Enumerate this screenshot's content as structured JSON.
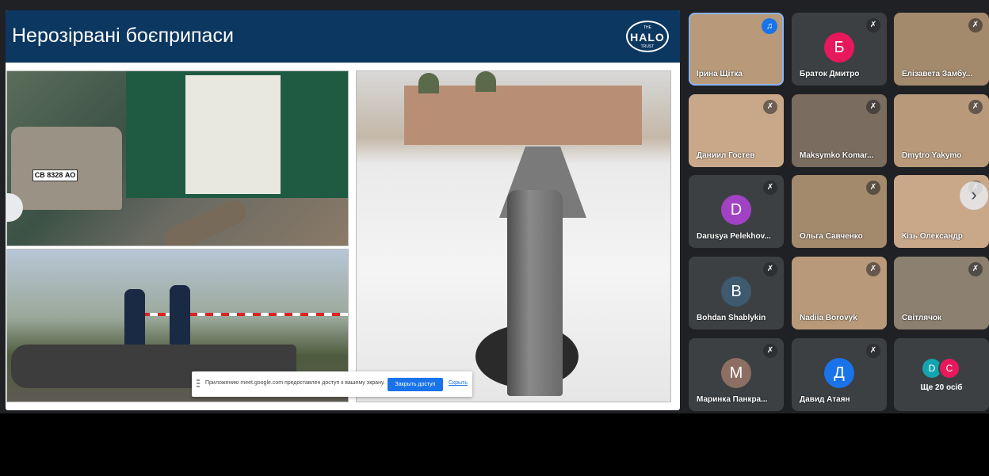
{
  "slide": {
    "title": "Нерозірвані боєприпаси",
    "logo": {
      "top": "THE",
      "main": "HALO",
      "bottom": "TRUST"
    },
    "license_plate": "СВ 8328 АО"
  },
  "share_bar": {
    "message": "Приложению meet.google.com предоставлен доступ к вашему экрану.",
    "stop_label": "Закрыть доступ",
    "hide_label": "Скрыть"
  },
  "participants": [
    {
      "name": "Ірина Щітка",
      "mic": "on"
    },
    {
      "name": "Браток Дмитро",
      "initial": "Б",
      "color": "#e8185c",
      "mic": "off"
    },
    {
      "name": "Елізавета Замбу...",
      "mic": "off"
    },
    {
      "name": "Даниил Гостев",
      "mic": "off"
    },
    {
      "name": "Maksymko Komar...",
      "mic": "off"
    },
    {
      "name": "Dmytro Yakymo",
      "mic": "off"
    },
    {
      "name": "Darusya Pelekhov...",
      "initial": "D",
      "color": "#a142c4",
      "mic": "off"
    },
    {
      "name": "Ольга Савченко",
      "mic": "off"
    },
    {
      "name": "Кізь Олександр",
      "mic": "off"
    },
    {
      "name": "Bohdan Shablykin",
      "initial": "B",
      "color": "#3d5a6e",
      "mic": "off"
    },
    {
      "name": "Nadiia Borovyk",
      "mic": "off"
    },
    {
      "name": "Світлячок",
      "mic": "off"
    },
    {
      "name": "Маринка Панкра...",
      "initial": "M",
      "color": "#8d6e63",
      "mic": "off"
    },
    {
      "name": "Давид Атаян",
      "initial": "Д",
      "color": "#1a73e8",
      "mic": "off"
    }
  ],
  "more": {
    "label": "Ще 20 осіб",
    "avatars": [
      {
        "initial": "D",
        "color": "#12a4af"
      },
      {
        "initial": "C",
        "color": "#e8185c"
      }
    ]
  },
  "icons": {
    "mic_off": "mic-off-icon",
    "mic_on": "mic-on-icon",
    "next": "chevron-right-icon",
    "prev": "chevron-left-icon"
  }
}
